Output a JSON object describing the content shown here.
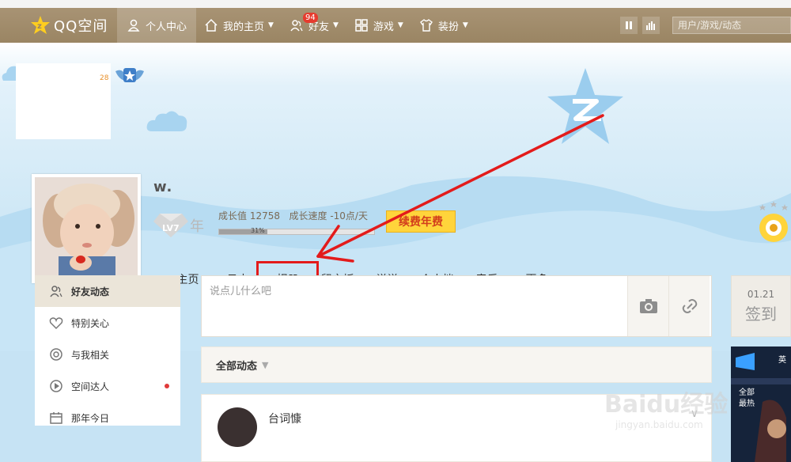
{
  "topbar": {
    "logo_text": "QQ空间",
    "nav": [
      {
        "label": "个人中心",
        "icon": "person-icon"
      },
      {
        "label": "我的主页",
        "icon": "home-icon"
      },
      {
        "label": "好友",
        "icon": "friends-icon",
        "badge": "94"
      },
      {
        "label": "游戏",
        "icon": "grid-icon"
      },
      {
        "label": "装扮",
        "icon": "shirt-icon"
      }
    ],
    "search_placeholder": "用户/游戏/动态"
  },
  "profile": {
    "corner_badge": "28",
    "username": "w.",
    "level_badge": "LV7",
    "year_label": "年",
    "growth_label": "成长值",
    "growth_value": "12758",
    "speed_label": "成长速度",
    "speed_value": "-10点/天",
    "progress_percent": 31,
    "progress_label": "31%",
    "renew_button": "续费年费"
  },
  "tabs": [
    "主页",
    "日志",
    "相册",
    "留言板",
    "说说",
    "个人档",
    "音乐",
    "更多"
  ],
  "left_menu": [
    {
      "label": "好友动态",
      "icon": "friends-icon"
    },
    {
      "label": "特别关心",
      "icon": "heart-icon"
    },
    {
      "label": "与我相关",
      "icon": "at-icon"
    },
    {
      "label": "空间达人",
      "icon": "play-icon",
      "dot": true
    },
    {
      "label": "那年今日",
      "icon": "calendar-icon"
    }
  ],
  "post_box": {
    "placeholder": "说点儿什么吧"
  },
  "feed": {
    "header": "全部动态",
    "first_item_name": "台词慷"
  },
  "checkin": {
    "date": "01.21",
    "label": "签到"
  },
  "game_ad": {
    "label_top": "全部",
    "label_bottom": "最热",
    "title_fragment": "英"
  },
  "watermark": {
    "brand": "Baidu经验",
    "url": "jingyan.baidu.com"
  },
  "colors": {
    "topbar": "#9a8563",
    "sky": "#c6e3f4",
    "annotation_red": "#e31b1b",
    "renew_yellow": "#ffd43b"
  }
}
